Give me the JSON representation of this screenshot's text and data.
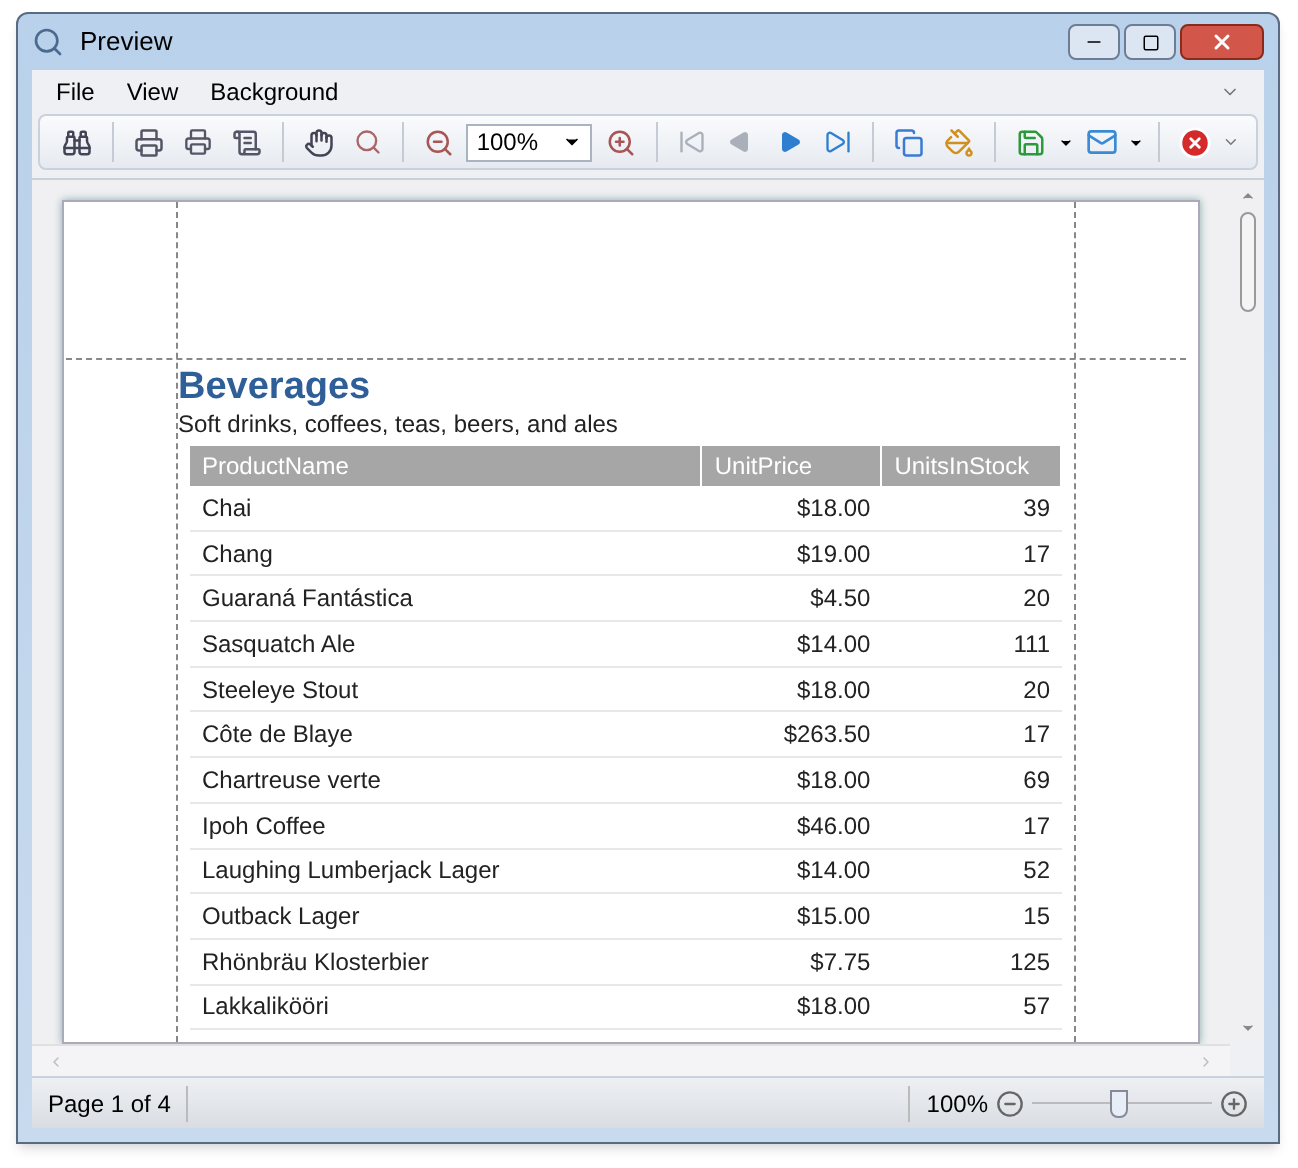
{
  "window": {
    "title": "Preview"
  },
  "menu": [
    {
      "label": "File"
    },
    {
      "label": "View"
    },
    {
      "label": "Background"
    }
  ],
  "toolbar": {
    "zoom_combo": {
      "value": "100%"
    },
    "nav_buttons": [
      {
        "disabled": true
      },
      {
        "disabled": true
      },
      {
        "disabled": false
      },
      {
        "disabled": false
      }
    ]
  },
  "report": {
    "title": "Beverages",
    "subtitle": "Soft drinks, coffees, teas, beers, and ales",
    "columns": [
      "ProductName",
      "UnitPrice",
      "UnitsInStock"
    ],
    "rows": [
      [
        "Chai",
        "$18.00",
        "39"
      ],
      [
        "Chang",
        "$19.00",
        "17"
      ],
      [
        "Guaraná Fantástica",
        "$4.50",
        "20"
      ],
      [
        "Sasquatch Ale",
        "$14.00",
        "111"
      ],
      [
        "Steeleye Stout",
        "$18.00",
        "20"
      ],
      [
        "Côte de Blaye",
        "$263.50",
        "17"
      ],
      [
        "Chartreuse verte",
        "$18.00",
        "69"
      ],
      [
        "Ipoh Coffee",
        "$46.00",
        "17"
      ],
      [
        "Laughing Lumberjack Lager",
        "$14.00",
        "52"
      ],
      [
        "Outback Lager",
        "$15.00",
        "15"
      ],
      [
        "Rhönbräu Klosterbier",
        "$7.75",
        "125"
      ],
      [
        "Lakkalikööri",
        "$18.00",
        "57"
      ]
    ]
  },
  "status_bar": {
    "page": "Page 1 of 4",
    "zoom": "100%",
    "zoom_slider": {
      "level": 0.48
    }
  }
}
